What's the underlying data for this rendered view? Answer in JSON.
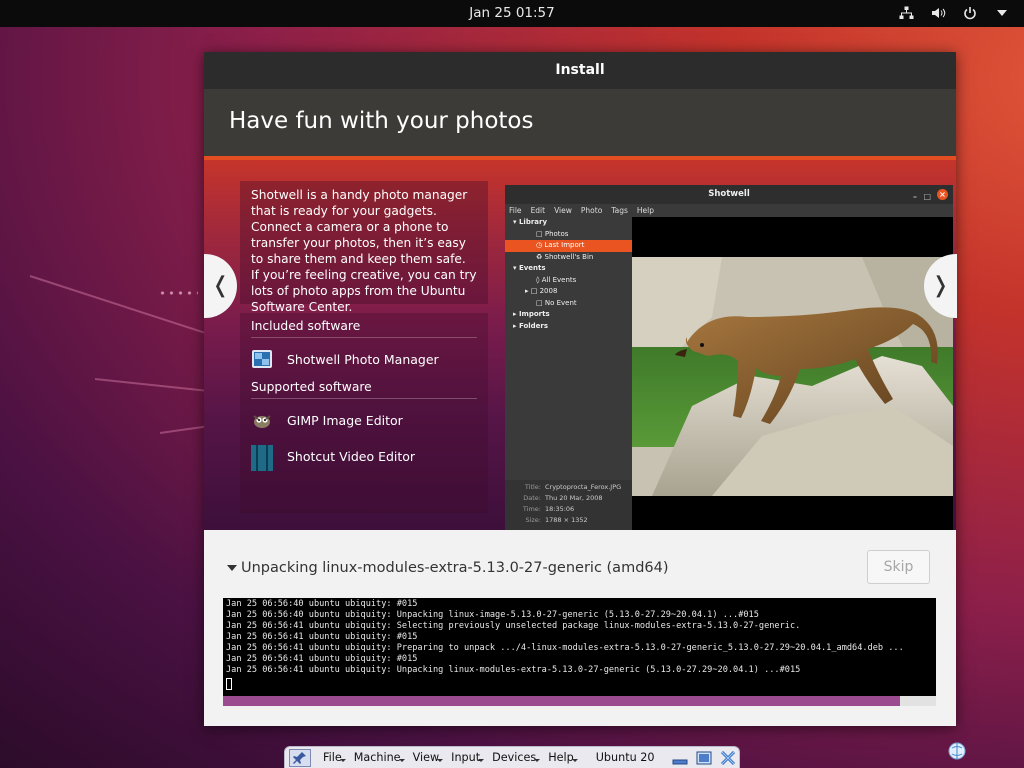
{
  "topbar": {
    "clock": "Jan 25  01:57",
    "icons": [
      "network-icon",
      "volume-icon",
      "power-icon",
      "chevron-down-icon"
    ]
  },
  "window": {
    "title": "Install",
    "slide_title": "Have fun with your photos",
    "description": "Shotwell is a handy photo manager that is ready for your gadgets. Connect a camera or a phone to transfer your photos, then it’s easy to share them and keep them safe. If you’re feeling creative, you can try lots of photo apps from the Ubuntu Software Center.",
    "included_title": "Included software",
    "included": [
      {
        "name": "Shotwell Photo Manager",
        "icon": "shotwell-icon"
      }
    ],
    "supported_title": "Supported software",
    "supported": [
      {
        "name": "GIMP Image Editor",
        "icon": "gimp-icon"
      },
      {
        "name": "Shotcut Video Editor",
        "icon": "shotcut-icon"
      }
    ],
    "prev_arrow": "❬",
    "next_arrow": "❭",
    "screenshot": {
      "title": "Shotwell",
      "menu": [
        "File",
        "Edit",
        "View",
        "Photo",
        "Tags",
        "Help"
      ],
      "sidebar": [
        "Library",
        "Photos",
        "Last Import",
        "Shotwell's Bin",
        "Events",
        "All Events",
        "2008",
        "No Event",
        "Imports",
        "Folders"
      ],
      "info_labels": [
        "Title:",
        "Date:",
        "Time:",
        "Size:"
      ],
      "info_values": [
        "Cryptoprocta_Ferox.JPG",
        "Thu 20 Mar, 2008",
        "18:35:06",
        "1788 × 1352"
      ]
    },
    "status": "Unpacking linux-modules-extra-5.13.0-27-generic (amd64)",
    "skip_label": "Skip",
    "terminal_lines": [
      "Jan 25 06:56:40 ubuntu ubiquity: #015",
      "Jan 25 06:56:40 ubuntu ubiquity: Unpacking linux-image-5.13.0-27-generic (5.13.0-27.29~20.04.1) ...#015",
      "Jan 25 06:56:41 ubuntu ubiquity: Selecting previously unselected package linux-modules-extra-5.13.0-27-generic.",
      "Jan 25 06:56:41 ubuntu ubiquity: #015",
      "Jan 25 06:56:41 ubuntu ubiquity: Preparing to unpack .../4-linux-modules-extra-5.13.0-27-generic_5.13.0-27.29~20.04.1_amd64.deb ...",
      "Jan 25 06:56:41 ubuntu ubiquity: #015",
      "Jan 25 06:56:41 ubuntu ubiquity: Unpacking linux-modules-extra-5.13.0-27-generic (5.13.0-27.29~20.04.1) ...#015"
    ],
    "progress": 0.95
  },
  "vbox": {
    "menus": [
      "File",
      "Machine",
      "View",
      "Input",
      "Devices",
      "Help"
    ],
    "vm_name": "Ubuntu 20"
  }
}
